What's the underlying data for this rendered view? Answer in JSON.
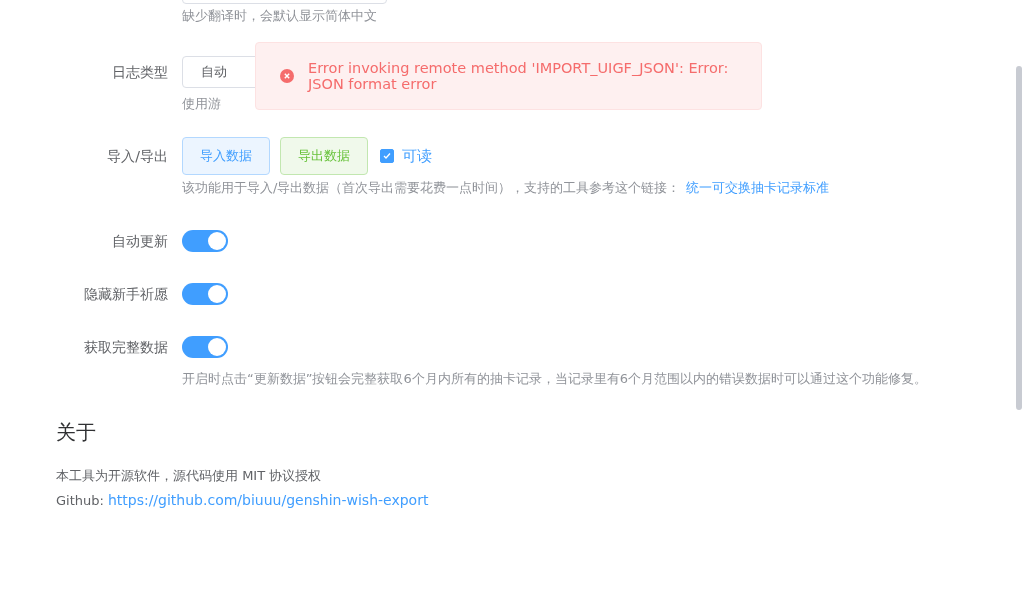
{
  "settings": [
    {
      "kind": "hint-only",
      "hint": "缺少翻译时，会默认显示简体中文"
    },
    {
      "kind": "select",
      "label": "日志类型",
      "value": "自动",
      "hint": "使用游"
    },
    {
      "kind": "buttons",
      "label": "导入/导出",
      "buttons": [
        {
          "label": "导入数据",
          "kind": "primary"
        },
        {
          "label": "导出数据",
          "kind": "success"
        }
      ],
      "checkbox": {
        "label": "可读",
        "checked": true
      },
      "hint": "该功能用于导入/导出数据（首次导出需要花费一点时间），支持的工具参考这个链接：",
      "link": "统一可交换抽卡记录标准"
    },
    {
      "kind": "switch",
      "label": "自动更新",
      "on": true
    },
    {
      "kind": "switch",
      "label": "隐藏新手祈愿",
      "on": true
    },
    {
      "kind": "switch",
      "label": "获取完整数据",
      "on": true,
      "hint": "开启时点击“更新数据”按钮会完整获取6个月内所有的抽卡记录，当记录里有6个月范围以内的错误数据时可以通过这个功能修复。"
    }
  ],
  "about": {
    "title": "关于",
    "license": "本工具为开源软件，源代码使用 MIT 协议授权",
    "github_label": "Github:",
    "github_link": "https://github.com/biuuu/genshin-wish-export"
  },
  "toast": {
    "kind": "error",
    "message": "Error invoking remote method 'IMPORT_UIGF_JSON': Error: JSON format error"
  }
}
